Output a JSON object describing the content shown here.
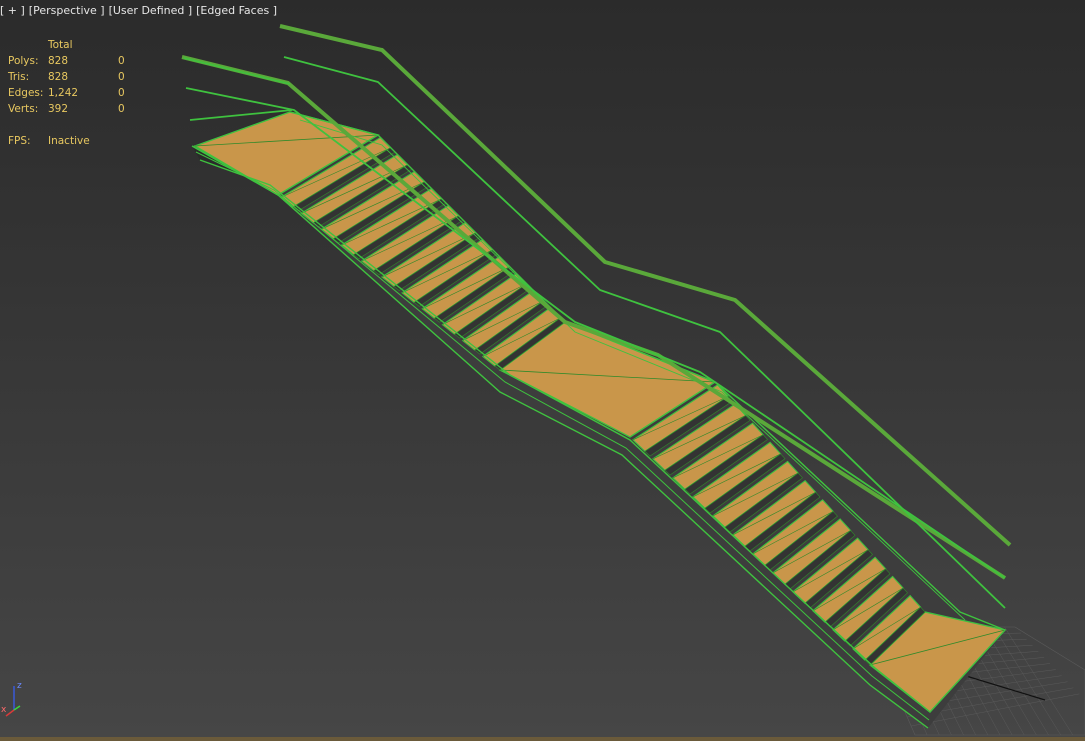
{
  "viewport": {
    "labels": [
      "[ + ]",
      "[Perspective ]",
      "[User Defined ]",
      "[Edged Faces ]"
    ]
  },
  "stats": {
    "header": "Total",
    "rows": [
      {
        "label": "Polys:",
        "total": "828",
        "selected": "0"
      },
      {
        "label": "Tris:",
        "total": "828",
        "selected": "0"
      },
      {
        "label": "Edges:",
        "total": "1,242",
        "selected": "0"
      },
      {
        "label": "Verts:",
        "total": "392",
        "selected": "0"
      }
    ],
    "fps_label": "FPS:",
    "fps_value": "Inactive"
  },
  "axis": {
    "z": "z",
    "x": "x"
  },
  "colors": {
    "background": "#2e2e2e",
    "wire": "#3fc23f",
    "wire_dark": "#2f8a2a",
    "tread": "#c9964a",
    "rail": "#5aa83a",
    "stats_text": "#e8c860",
    "label_text": "#e6e6e6"
  }
}
